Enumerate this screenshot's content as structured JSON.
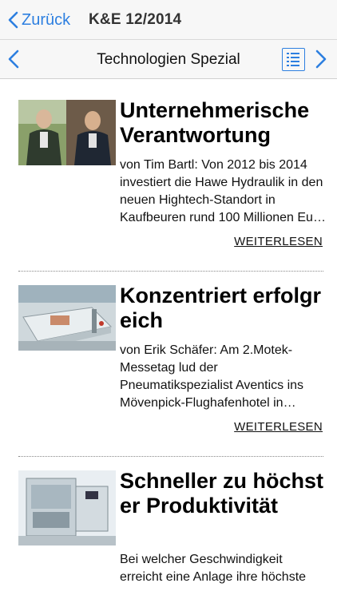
{
  "nav": {
    "back_label": "Zurück",
    "issue_title": "K&E 12/2014"
  },
  "section": {
    "title": "Technologien Spezial"
  },
  "articles": [
    {
      "title": "Unternehmerische Verantwortung",
      "teaser": "von Tim Bartl: Von 2012 bis 2014 investiert die Hawe Hydraulik in den neuen Hightech-Standort in Kaufbeuren rund 100 Millionen Eu…",
      "more": "WEITERLESEN"
    },
    {
      "title": "Konzentriert erfolgreich",
      "teaser": "von Erik Schäfer: Am 2.Motek-Messetag lud der Pneumatikspezialist Aventics ins Mövenpick-Flughafenhotel in…",
      "more": "WEITERLESEN"
    },
    {
      "title": "Schneller zu höchster Produktivität",
      "teaser": "Bei welcher Geschwindigkeit erreicht eine Anlage ihre höchste",
      "more": ""
    }
  ],
  "colors": {
    "accent": "#2d7fe0"
  }
}
